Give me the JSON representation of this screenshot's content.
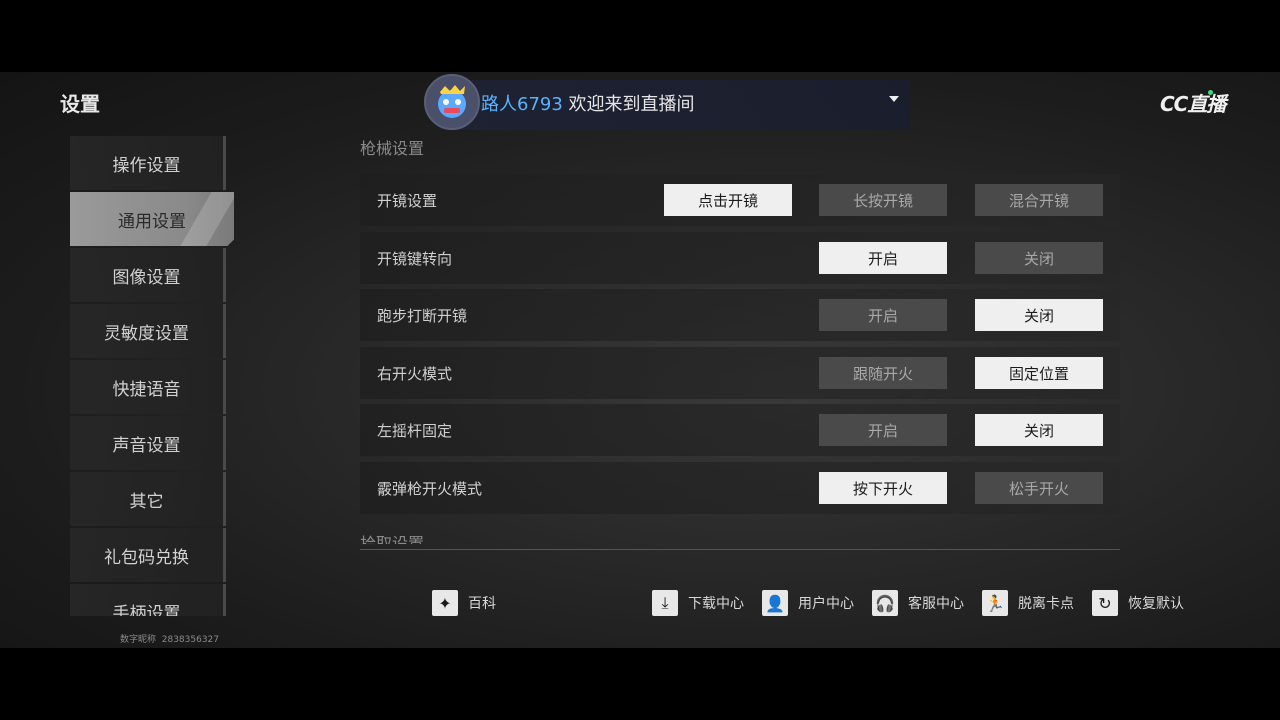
{
  "title": "设置",
  "stream": {
    "username": "路人6793",
    "welcome": "欢迎来到直播间"
  },
  "logo": "CC直播",
  "sidebar": {
    "items": [
      {
        "label": "操作设置"
      },
      {
        "label": "通用设置"
      },
      {
        "label": "图像设置"
      },
      {
        "label": "灵敏度设置"
      },
      {
        "label": "快捷语音"
      },
      {
        "label": "声音设置"
      },
      {
        "label": "其它"
      },
      {
        "label": "礼包码兑换"
      },
      {
        "label": "手柄设置"
      }
    ],
    "active_index": 1,
    "account_label": "数字昵称",
    "account_id": "2838356327"
  },
  "main": {
    "section_title": "枪械设置",
    "next_section_title": "拾取设置",
    "rows": [
      {
        "label": "开镜设置",
        "options": [
          "点击开镜",
          "长按开镜",
          "混合开镜"
        ],
        "selected": 0
      },
      {
        "label": "开镜键转向",
        "options": [
          "开启",
          "关闭"
        ],
        "selected": 0
      },
      {
        "label": "跑步打断开镜",
        "options": [
          "开启",
          "关闭"
        ],
        "selected": 1
      },
      {
        "label": "右开火模式",
        "options": [
          "跟随开火",
          "固定位置"
        ],
        "selected": 1
      },
      {
        "label": "左摇杆固定",
        "options": [
          "开启",
          "关闭"
        ],
        "selected": 1
      },
      {
        "label": "霰弹枪开火模式",
        "options": [
          "按下开火",
          "松手开火"
        ],
        "selected": 0
      }
    ]
  },
  "footer": {
    "wiki": "百科",
    "download": "下载中心",
    "user_center": "用户中心",
    "support": "客服中心",
    "unstuck": "脱离卡点",
    "restore": "恢复默认"
  },
  "colors": {
    "username": "#59b4ff",
    "selected_option": "#efefef",
    "unselected_option": "#4a4a4a",
    "active_tab": "#9a9a9a"
  }
}
